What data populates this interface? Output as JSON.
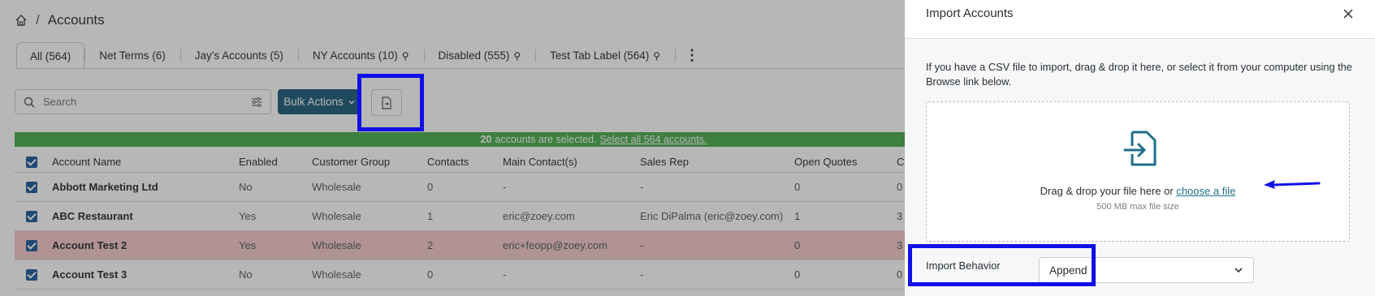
{
  "breadcrumb": {
    "home_icon": "home-icon",
    "separator": "/",
    "title": "Accounts"
  },
  "tabs": [
    {
      "label": "All (564)",
      "restricted": false
    },
    {
      "label": "Net Terms (6)",
      "restricted": false
    },
    {
      "label": "Jay's Accounts (5)",
      "restricted": false
    },
    {
      "label": "NY Accounts (10)",
      "restricted": true
    },
    {
      "label": "Disabled (555)",
      "restricted": true
    },
    {
      "label": "Test Tab Label (564)",
      "restricted": true
    }
  ],
  "toolbar": {
    "search_placeholder": "Search",
    "bulk_actions_label": "Bulk Actions"
  },
  "selection_banner": {
    "count": "20",
    "text": "accounts are selected.",
    "select_all_link": "Select all 564 accounts."
  },
  "table": {
    "columns": [
      "Account Name",
      "Enabled",
      "Customer Group",
      "Contacts",
      "Main Contact(s)",
      "Sales Rep",
      "Open Quotes",
      "C"
    ],
    "rows": [
      {
        "name": "Abbott Marketing Ltd",
        "enabled": "No",
        "group": "Wholesale",
        "contacts": "0",
        "main_contact": "-",
        "sales_rep": "-",
        "open_quotes": "0",
        "c": "0",
        "highlight": false
      },
      {
        "name": "ABC Restaurant",
        "enabled": "Yes",
        "group": "Wholesale",
        "contacts": "1",
        "main_contact": "eric@zoey.com",
        "sales_rep": "Eric DiPalma (eric@zoey.com)",
        "open_quotes": "1",
        "c": "3",
        "highlight": false
      },
      {
        "name": "Account Test 2",
        "enabled": "Yes",
        "group": "Wholesale",
        "contacts": "2",
        "main_contact": "eric+feopp@zoey.com",
        "sales_rep": "-",
        "open_quotes": "0",
        "c": "3",
        "highlight": true
      },
      {
        "name": "Account Test 3",
        "enabled": "No",
        "group": "Wholesale",
        "contacts": "0",
        "main_contact": "-",
        "sales_rep": "-",
        "open_quotes": "0",
        "c": "0",
        "highlight": false
      }
    ]
  },
  "import_panel": {
    "title": "Import Accounts",
    "intro": "If you have a CSV file to import, drag & drop it here, or select it from your computer using the Browse link below.",
    "drop_text": "Drag & drop your file here or",
    "choose_link": "choose a file",
    "max_size": "500 MB max file size",
    "behavior_label": "Import Behavior",
    "behavior_value": "Append"
  },
  "colors": {
    "accent": "#1f5f7c",
    "highlight_box": "#1010e6",
    "banner": "#4caf50",
    "row_warning": "#f7cbcb"
  }
}
